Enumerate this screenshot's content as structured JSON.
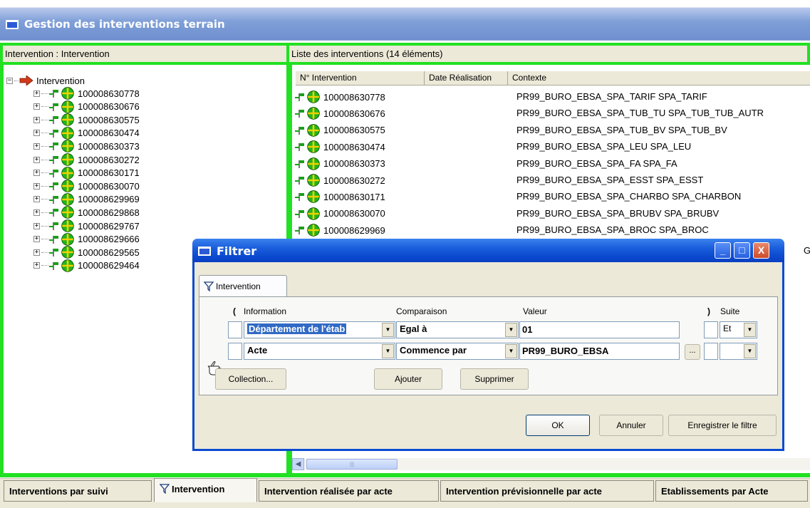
{
  "app": {
    "title": "Gestion des interventions terrain"
  },
  "left_pane": {
    "header": "Intervention : Intervention",
    "root_label": "Intervention",
    "items": [
      "100008630778",
      "100008630676",
      "100008630575",
      "100008630474",
      "100008630373",
      "100008630272",
      "100008630171",
      "100008630070",
      "100008629969",
      "100008629868",
      "100008629767",
      "100008629666",
      "100008629565",
      "100008629464"
    ]
  },
  "right_pane": {
    "header": "Liste des interventions  (14 éléments)",
    "columns": [
      "N° Intervention",
      "Date Réalisation",
      "Contexte"
    ],
    "rows": [
      {
        "num": "100008630778",
        "date": "",
        "context": "PR99_BURO_EBSA_SPA_TARIF SPA_TARIF"
      },
      {
        "num": "100008630676",
        "date": "",
        "context": "PR99_BURO_EBSA_SPA_TUB_TU SPA_TUB_TUB_AUTR"
      },
      {
        "num": "100008630575",
        "date": "",
        "context": "PR99_BURO_EBSA_SPA_TUB_BV SPA_TUB_BV"
      },
      {
        "num": "100008630474",
        "date": "",
        "context": "PR99_BURO_EBSA_SPA_LEU SPA_LEU"
      },
      {
        "num": "100008630373",
        "date": "",
        "context": "PR99_BURO_EBSA_SPA_FA SPA_FA"
      },
      {
        "num": "100008630272",
        "date": "",
        "context": "PR99_BURO_EBSA_SPA_ESST SPA_ESST"
      },
      {
        "num": "100008630171",
        "date": "",
        "context": "PR99_BURO_EBSA_SPA_CHARBO SPA_CHARBON"
      },
      {
        "num": "100008630070",
        "date": "",
        "context": "PR99_BURO_EBSA_SPA_BRUBV SPA_BRUBV"
      },
      {
        "num": "100008629969",
        "date": "",
        "context": "PR99_BURO_EBSA_SPA_BROC SPA_BROC"
      }
    ],
    "partial_text": "G"
  },
  "bottom_tabs": [
    "Interventions par suivi",
    "Intervention",
    "Intervention réalisée par acte",
    "Intervention prévisionnelle par acte",
    "Etablissements par Acte"
  ],
  "dialog": {
    "title": "Filtrer",
    "tab_label": "Intervention",
    "headers": {
      "open_paren": "(",
      "information": "Information",
      "comparison": "Comparaison",
      "value": "Valeur",
      "close_paren": ")",
      "suite": "Suite"
    },
    "rows": [
      {
        "information": "Département de l'étab",
        "comparison": "Egal à",
        "value": "01",
        "suite": "Et"
      },
      {
        "information": "Acte",
        "comparison": "Commence par",
        "value": "PR99_BURO_EBSA",
        "suite": ""
      }
    ],
    "ellipsis": "...",
    "buttons": {
      "collection": "Collection...",
      "add": "Ajouter",
      "delete": "Supprimer",
      "ok": "OK",
      "cancel": "Annuler",
      "save_filter": "Enregistrer le filtre"
    },
    "window_buttons": {
      "minimize": "_",
      "maximize": "□",
      "close": "X"
    }
  },
  "colors": {
    "frame_green": "#22e022",
    "xp_blue": "#0b4ad0",
    "selection": "#316ac5"
  },
  "icons": [
    "arrow-icon",
    "flag-icon",
    "globe-icon",
    "funnel-icon",
    "pointing-hand-icon",
    "window-icon"
  ]
}
